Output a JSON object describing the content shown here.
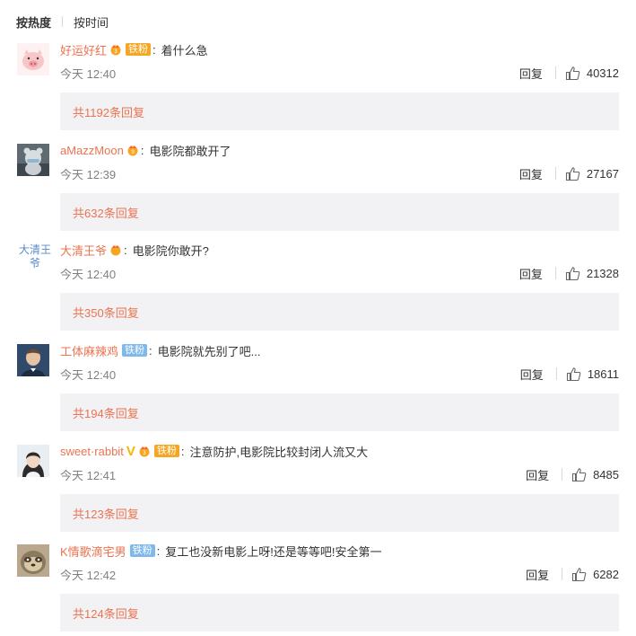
{
  "tabs": {
    "hot": "按热度",
    "time": "按时间"
  },
  "comments": [
    {
      "user": "好运好红",
      "badge": "铁粉",
      "badge_color": "orange",
      "vip": true,
      "text": "着什么急",
      "time": "今天 12:40",
      "reply": "回复",
      "likes": "40312",
      "replies": "共1192条回复",
      "avatar": "pig-avatar"
    },
    {
      "user": "aMazzMoon",
      "badge": "",
      "vip": true,
      "text": "电影院都敢开了",
      "time": "今天 12:39",
      "reply": "回复",
      "likes": "27167",
      "replies": "共632条回复",
      "avatar": "toy-avatar"
    },
    {
      "user": "大清王爷",
      "badge": "",
      "vip": true,
      "text": "电影院你敢开?",
      "time": "今天 12:40",
      "reply": "回复",
      "likes": "21328",
      "replies": "共350条回复",
      "avatar_alt": "大清王爷"
    },
    {
      "user": "工体麻辣鸡",
      "badge": "铁粉",
      "badge_color": "blue",
      "vip": false,
      "text": "电影院就先别了吧...",
      "time": "今天 12:40",
      "reply": "回复",
      "likes": "18611",
      "replies": "共194条回复",
      "avatar": "boy-avatar"
    },
    {
      "user": "sweet·rabbit",
      "badge": "铁粉",
      "badge_color": "orange",
      "vip": true,
      "vmark": "V",
      "text": "注意防护,电影院比较封闭人流又大",
      "time": "今天 12:41",
      "reply": "回复",
      "likes": "8485",
      "replies": "共123条回复",
      "avatar": "girl-avatar"
    },
    {
      "user": "K情歌滴宅男",
      "badge": "铁粉",
      "badge_color": "blue",
      "vip": false,
      "text": "复工也没新电影上呀!还是等等吧!安全第一",
      "time": "今天 12:42",
      "reply": "回复",
      "likes": "6282",
      "replies": "共124条回复",
      "avatar": "sloth-avatar"
    }
  ]
}
